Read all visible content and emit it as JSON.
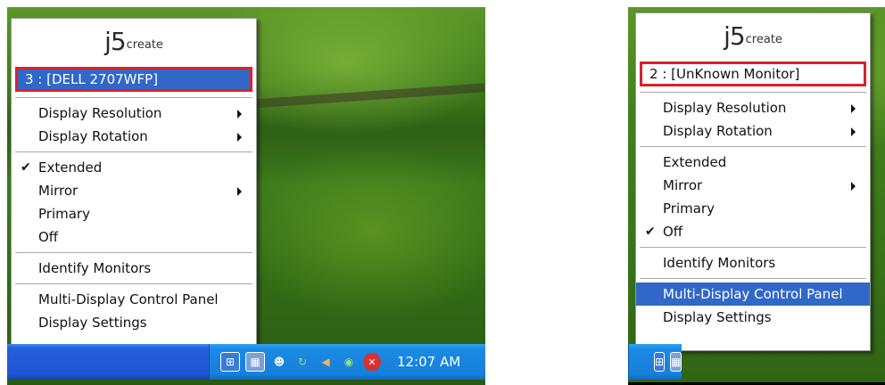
{
  "left": {
    "menu": {
      "logo": {
        "brand": "j5",
        "suffix": "create"
      },
      "monitor_label": "3 : [DELL 2707WFP]",
      "items": {
        "display_resolution": "Display Resolution",
        "display_rotation": "Display Rotation",
        "extended": "Extended",
        "mirror": "Mirror",
        "primary": "Primary",
        "off": "Off",
        "identify_monitors": "Identify Monitors",
        "control_panel": "Multi-Display Control Panel",
        "display_settings": "Display Settings"
      },
      "checked": "Extended",
      "check_glyph": "✔"
    },
    "taskbar": {
      "clock": "12:07 AM",
      "tray_icons": [
        "network-icon",
        "j5-icon",
        "messenger-icon",
        "sync-icon",
        "volume-icon",
        "nvidia-icon",
        "security-icon"
      ]
    }
  },
  "right": {
    "menu": {
      "logo": {
        "brand": "j5",
        "suffix": "create"
      },
      "monitor_label": "2 : [UnKnown Monitor]",
      "items": {
        "display_resolution": "Display Resolution",
        "display_rotation": "Display Rotation",
        "extended": "Extended",
        "mirror": "Mirror",
        "primary": "Primary",
        "off": "Off",
        "identify_monitors": "Identify Monitors",
        "control_panel": "Multi-Display Control Panel",
        "display_settings": "Display Settings"
      },
      "checked": "Off",
      "check_glyph": "✔",
      "highlighted": "Multi-Display Control Panel"
    },
    "taskbar": {
      "tray_icons": [
        "network-icon",
        "j5-icon"
      ]
    }
  },
  "colors": {
    "highlight": "#3168c8",
    "annotation_box": "#d9232b",
    "taskbar": "#245edb",
    "tray": "#1a8ae6"
  }
}
